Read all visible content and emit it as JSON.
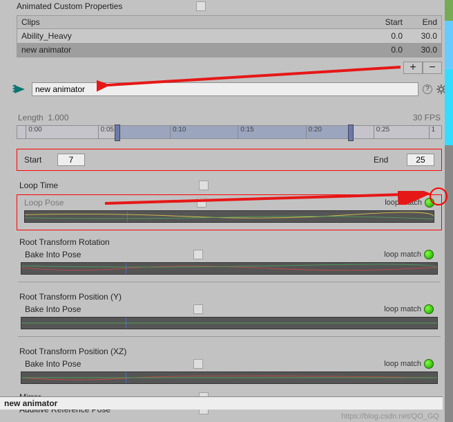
{
  "top": {
    "anim_custom": "Animated Custom Properties",
    "clips_label": "Clips",
    "start_label": "Start",
    "end_label": "End",
    "rows": [
      {
        "name": "Ability_Heavy",
        "start": "0.0",
        "end": "30.0"
      },
      {
        "name": "new animator",
        "start": "0.0",
        "end": "30.0"
      }
    ]
  },
  "name_field": "new animator",
  "timeline": {
    "length_label": "Length",
    "length_val": "1.000",
    "fps": "30 FPS",
    "ticks": [
      "0:00",
      "0:05",
      "0:10",
      "0:15",
      "0:20",
      "0:25",
      "1"
    ]
  },
  "startend": {
    "start_label": "Start",
    "start_val": "7",
    "end_label": "End",
    "end_val": "25"
  },
  "loop": {
    "time_label": "Loop Time",
    "pose_label": "Loop Pose",
    "match": "loop match"
  },
  "sections": [
    {
      "title": "Root Transform Rotation",
      "bake": "Bake Into Pose",
      "match": "loop match"
    },
    {
      "title": "Root Transform Position (Y)",
      "bake": "Bake Into Pose",
      "match": "loop match"
    },
    {
      "title": "Root Transform Position (XZ)",
      "bake": "Bake Into Pose",
      "match": "loop match"
    }
  ],
  "mirror": "Mirror",
  "additive": "Additive Reference Pose",
  "bottom": "new animator",
  "watermark": "https://blog.csdn.net/QO_GQ"
}
